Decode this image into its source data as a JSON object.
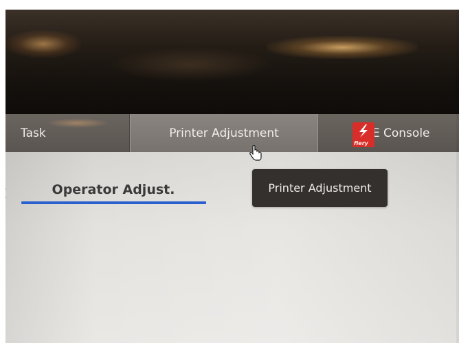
{
  "nav_tabs": {
    "task_label": "Task",
    "printer_adjustment_label": "Printer Adjustment",
    "dfe_console_label": "DFE Console",
    "fiery_logo_text": "fiery"
  },
  "subtabs": {
    "operator_adjust_label": "Operator Adjust."
  },
  "tooltip": {
    "text": "Printer Adjustment"
  },
  "colors": {
    "tab_bar": "#5f5a55",
    "active_tab": "#807b76",
    "accent_underline": "#2a5fcf",
    "tooltip_bg": "#33302d",
    "fiery_red": "#d92d2a",
    "back_arrow": "#2a5fcf"
  },
  "icons": {
    "fiery": "fiery-logo-icon",
    "cursor": "hand-pointer-icon",
    "back": "back-arrow-icon"
  }
}
